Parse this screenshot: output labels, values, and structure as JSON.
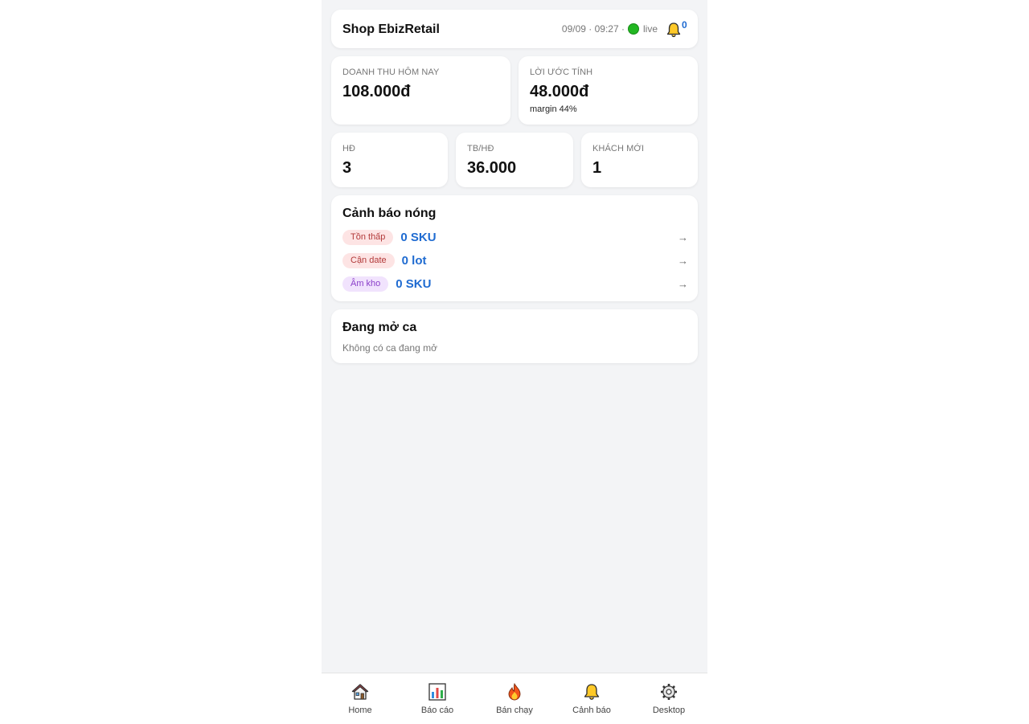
{
  "header": {
    "shop_name": "Shop EbizRetail",
    "datetime": "09/09 · 09:27 ·",
    "live_label": "live",
    "notification_count": "0"
  },
  "kpis": {
    "revenue": {
      "label": "DOANH THU HÔM NAY",
      "value": "108.000đ"
    },
    "profit": {
      "label": "LỜI ƯỚC TÍNH",
      "value": "48.000đ",
      "note": "margin 44%"
    },
    "invoices": {
      "label": "HĐ",
      "value": "3"
    },
    "avg_invoice": {
      "label": "TB/HĐ",
      "value": "36.000"
    },
    "new_customers": {
      "label": "KHÁCH MỚI",
      "value": "1"
    }
  },
  "alerts": {
    "title": "Cảnh báo nóng",
    "items": [
      {
        "tag": "Tồn thấp",
        "value": "0 SKU",
        "arrow": "→"
      },
      {
        "tag": "Cận date",
        "value": "0 lot",
        "arrow": "→"
      },
      {
        "tag": "Âm kho",
        "value": "0 SKU",
        "arrow": "→"
      }
    ]
  },
  "shift": {
    "title": "Đang mở ca",
    "empty_text": "Không có ca đang mở"
  },
  "nav": {
    "items": [
      {
        "label": "Home",
        "icon": "house-icon"
      },
      {
        "label": "Báo cáo",
        "icon": "bar-chart-icon"
      },
      {
        "label": "Bán chạy",
        "icon": "fire-icon"
      },
      {
        "label": "Cảnh báo",
        "icon": "bell-icon"
      },
      {
        "label": "Desktop",
        "icon": "gear-icon"
      }
    ]
  },
  "colors": {
    "accent_blue": "#1f6bd1",
    "live_green": "#22b722",
    "background": "#f3f4f6",
    "pill_red_bg": "#fde4e4",
    "pill_purple_bg": "#f1e3fd"
  }
}
